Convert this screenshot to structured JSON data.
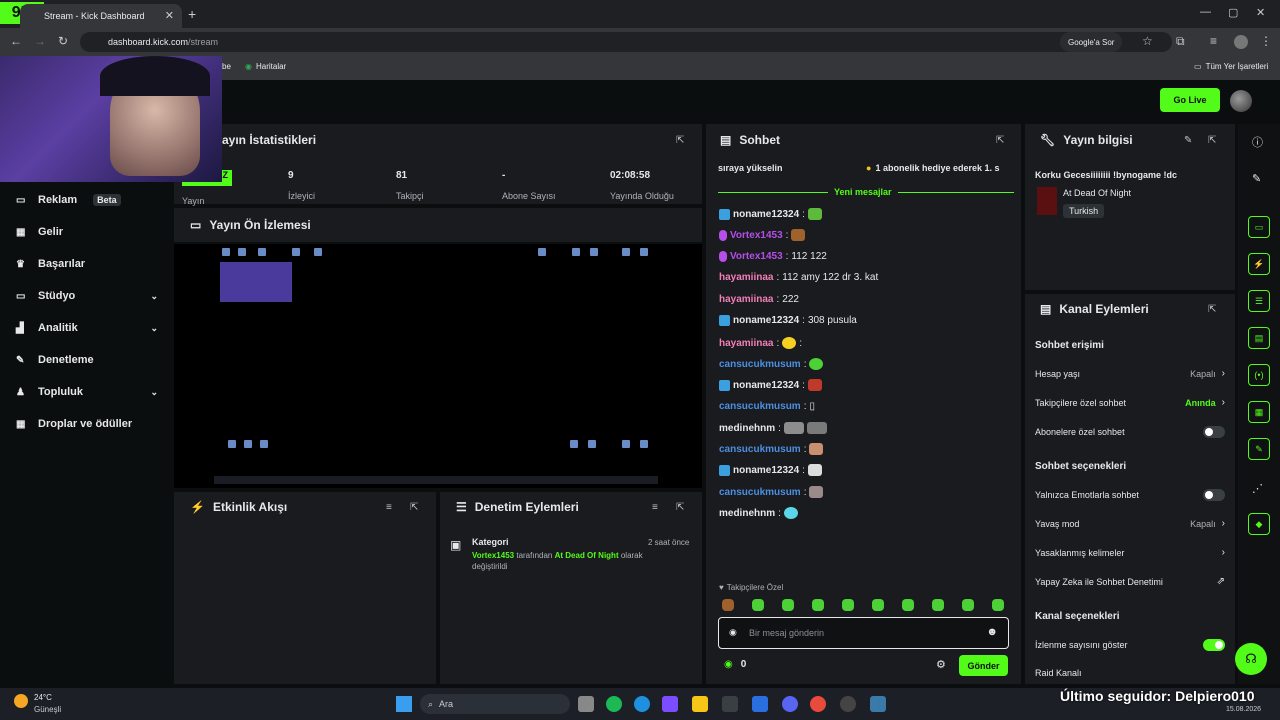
{
  "browser": {
    "tab_title": "Stream - Kick Dashboard",
    "logo_text": "9K",
    "url_host": "dashboard.kick.com",
    "url_path": "/stream",
    "google_sor": "Google'a Sor",
    "bookmark_1": "be",
    "bookmark_2": "Haritalar",
    "bookmarks_all": "Tüm Yer İşaretleri"
  },
  "header": {
    "go_live": "Go Live"
  },
  "sidebar": {
    "items": [
      {
        "label": "Reklam",
        "icon": "ad-icon",
        "badge": "Beta"
      },
      {
        "label": "Gelir",
        "icon": "revenue-icon"
      },
      {
        "label": "Başarılar",
        "icon": "trophy-icon"
      },
      {
        "label": "Stüdyo",
        "icon": "studio-icon",
        "chevron": true
      },
      {
        "label": "Analitik",
        "icon": "analytics-icon",
        "chevron": true
      },
      {
        "label": "Denetleme",
        "icon": "moderation-icon"
      },
      {
        "label": "Topluluk",
        "icon": "community-icon",
        "chevron": true
      },
      {
        "label": "Droplar ve ödüller",
        "icon": "drops-icon"
      }
    ]
  },
  "stats": {
    "title": "ayın İstatistikleri",
    "yayin_value": "Z",
    "yayin_label": "Yayın",
    "viewers_value": "9",
    "viewers_label": "İzleyici",
    "followers_value": "81",
    "followers_label": "Takipçi",
    "subs_value": "-",
    "subs_label": "Abone Sayısı",
    "duration_value": "02:08:58",
    "duration_label": "Yayında Olduğu"
  },
  "preview": {
    "title": "Yayın Ön İzlemesi"
  },
  "activity": {
    "title": "Etkinlik Akışı"
  },
  "mod_actions": {
    "title": "Denetim Eylemleri",
    "entry_title": "Kategori",
    "entry_time": "2 saat önce",
    "entry_user": "Vortex1453",
    "entry_mid": "tarafından",
    "entry_category": "At Dead Of Night",
    "entry_end": "olarak",
    "entry_end2": "değiştirildi"
  },
  "chat": {
    "title": "Sohbet",
    "pinned_left": "sıraya yükselin",
    "pinned_right": "1 abonelik hediye ederek 1. s",
    "new_messages": "Yeni mesajlar",
    "messages": [
      {
        "user": "noname12324",
        "text": "",
        "color": "#e6e8ea"
      },
      {
        "user": "Vortex1453",
        "text": "",
        "color": "#b64ee8"
      },
      {
        "user": "Vortex1453",
        "text": "112 122",
        "color": "#b64ee8"
      },
      {
        "user": "hayamiinaa",
        "text": "112 amy 122 dr 3. kat",
        "color": "#f27fb8"
      },
      {
        "user": "hayamiinaa",
        "text": "222",
        "color": "#f27fb8"
      },
      {
        "user": "noname12324",
        "text": "308 pusula",
        "color": "#e6e8ea"
      },
      {
        "user": "hayamiinaa",
        "text": ":",
        "color": "#f27fb8"
      },
      {
        "user": "cansucukmusum",
        "text": "",
        "color": "#4d8fe0"
      },
      {
        "user": "noname12324",
        "text": "",
        "color": "#e6e8ea"
      },
      {
        "user": "cansucukmusum",
        "text": "▯",
        "color": "#4d8fe0"
      },
      {
        "user": "medinehnm",
        "text": "",
        "color": "#e6e8ea"
      },
      {
        "user": "cansucukmusum",
        "text": "",
        "color": "#4d8fe0"
      },
      {
        "user": "noname12324",
        "text": "",
        "color": "#e6e8ea"
      },
      {
        "user": "cansucukmusum",
        "text": "",
        "color": "#4d8fe0"
      },
      {
        "user": "medinehnm",
        "text": "",
        "color": "#e6e8ea"
      }
    ],
    "followers_only": "Takipçilere Özel",
    "input_placeholder": "Bir mesaj gönderin",
    "points": "0",
    "send": "Gönder"
  },
  "stream_info": {
    "title": "Yayın bilgisi",
    "stream_title": "Korku Gecesiiiiiiii !bynogame !dc",
    "game": "At Dead Of Night",
    "language": "Turkish"
  },
  "channel_actions": {
    "title": "Kanal Eylemleri",
    "chat_access": "Sohbet erişimi",
    "account_age": "Hesap yaşı",
    "account_age_val": "Kapalı",
    "followers_chat": "Takipçilere özel sohbet",
    "followers_chat_val": "Anında",
    "subs_chat": "Abonelere özel sohbet",
    "chat_options": "Sohbet seçenekleri",
    "emote_only": "Yalnızca Emotlarla sohbet",
    "slow_mode": "Yavaş mod",
    "slow_mode_val": "Kapalı",
    "banned_words": "Yasaklanmış kelimeler",
    "ai_mod": "Yapay Zeka ile Sohbet Denetimi",
    "channel_options": "Kanal seçenekleri",
    "show_viewers": "İzlenme sayısını göster",
    "raid": "Raid Kanalı"
  },
  "overlay": {
    "last_follower": "Último seguidor: Delpiero010"
  },
  "taskbar": {
    "weather_temp": "24°C",
    "weather_text": "Güneşli",
    "search": "Ara",
    "date": "15.08.2026"
  }
}
